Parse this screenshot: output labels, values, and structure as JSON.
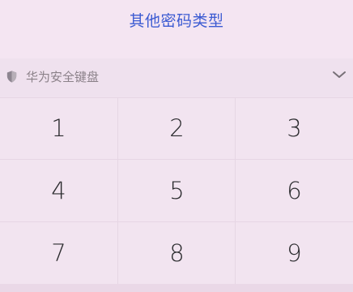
{
  "header": {
    "other_password_types": "其他密码类型"
  },
  "keyboard": {
    "title": "华为安全键盘",
    "shield_icon": "shield-icon",
    "collapse_icon": "chevron-down-icon",
    "keys": [
      "1",
      "2",
      "3",
      "4",
      "5",
      "6",
      "7",
      "8",
      "9"
    ]
  },
  "colors": {
    "link": "#3c5bd2",
    "background": "#f3e4f1",
    "key_text": "#2b2b2e",
    "muted_text": "#8b8189"
  }
}
